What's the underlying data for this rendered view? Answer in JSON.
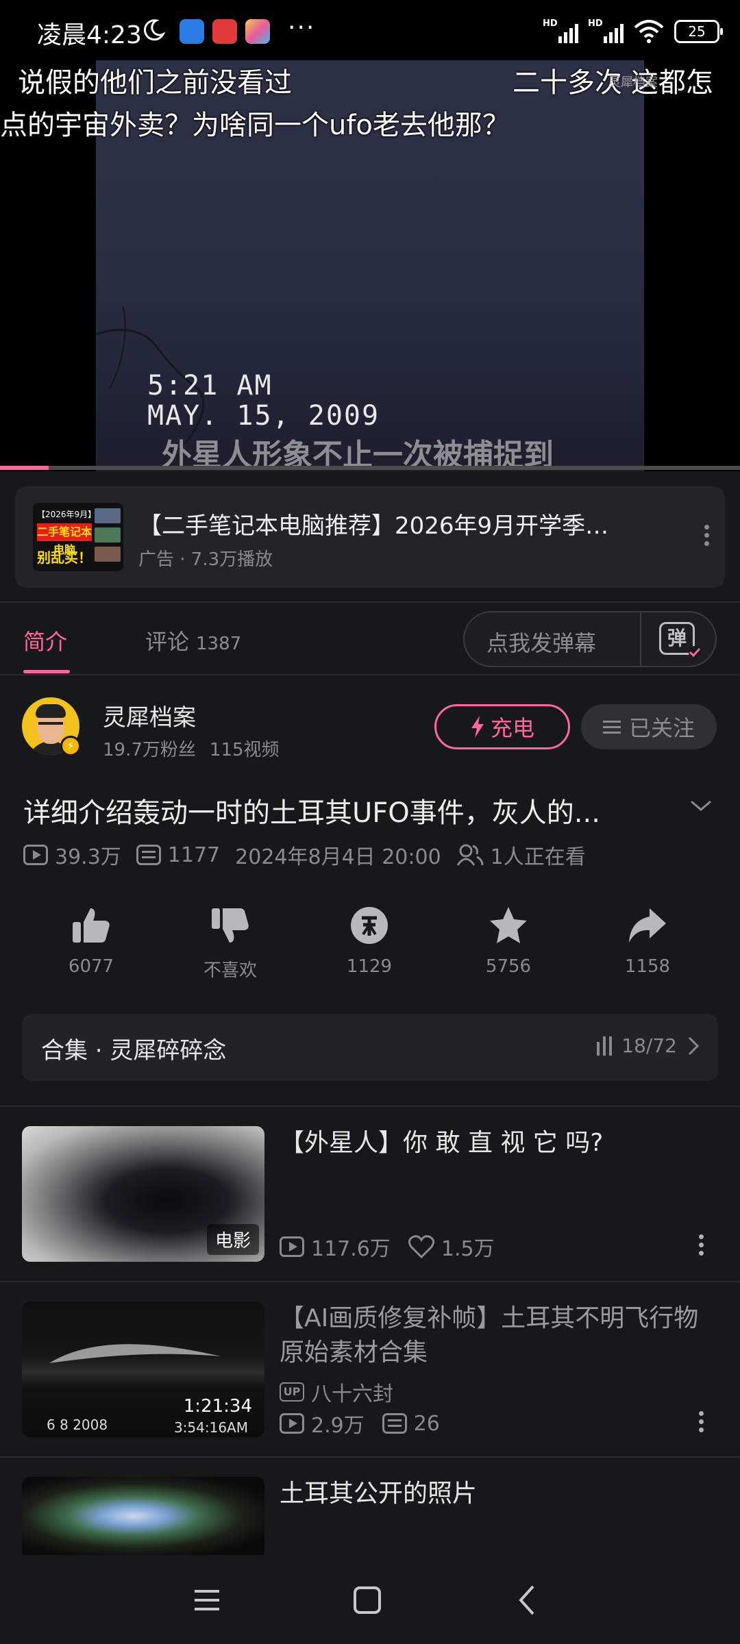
{
  "status_bar": {
    "time": "凌晨4:23",
    "more": "···",
    "sim1": "HD",
    "sim2": "HD",
    "battery": "25"
  },
  "player": {
    "danmaku": [
      "说假的他们之前没看过",
      "二十多次 这都怎",
      "点的宇宙外卖？为啥同一个ufo老去他那？"
    ],
    "watermark": "灵犀档案",
    "timestamp_time": "5:21 AM",
    "timestamp_date": "MAY. 15, 2009",
    "subtitle": "外星人形象不止一次被捕捉到",
    "progress": 0.066
  },
  "ad": {
    "title": "【二手笔记本电脑推荐】2026年9月开学季…",
    "meta": "广告 · 7.3万播放",
    "thumb_line1": "【2026年9月】",
    "thumb_line2": "二手笔记本电脑",
    "thumb_line3": "别乱买！"
  },
  "tabs": {
    "intro": "简介",
    "comments": "评论",
    "comments_count": "1387",
    "danmaku_placeholder": "点我发弹幕",
    "danmaku_icon": "弹"
  },
  "uploader": {
    "name": "灵犀档案",
    "fans": "19.7万粉丝",
    "videos": "115视频",
    "charge": "充电",
    "follow": "已关注"
  },
  "video": {
    "title": "详细介绍轰动一时的土耳其UFO事件，灰人的...",
    "views": "39.3万",
    "danmaku_count": "1177",
    "date": "2024年8月4日 20:00",
    "watching": "1人正在看"
  },
  "actions": {
    "like": "6077",
    "dislike": "不喜欢",
    "coin": "1129",
    "favorite": "5756",
    "share": "1158"
  },
  "collection": {
    "title": "合集 · 灵犀碎碎念",
    "progress": "18/72"
  },
  "recommended": [
    {
      "title": "【外星人】你 敢 直 视 它 吗?",
      "tag": "电影",
      "views": "117.6万",
      "likes": "1.5万"
    },
    {
      "title": "【AI画质修复补帧】土耳其不明飞行物原始素材合集",
      "uploader": "八十六封",
      "up_badge": "UP",
      "duration": "1:21:34",
      "thumb_date": "6   8 2008",
      "thumb_time": "3:54:16AM",
      "views": "2.9万",
      "danmaku": "26"
    },
    {
      "title": "土耳其公开的照片"
    }
  ],
  "colors": {
    "accent": "#ff6699",
    "background": "#17181a",
    "card": "#232427"
  }
}
